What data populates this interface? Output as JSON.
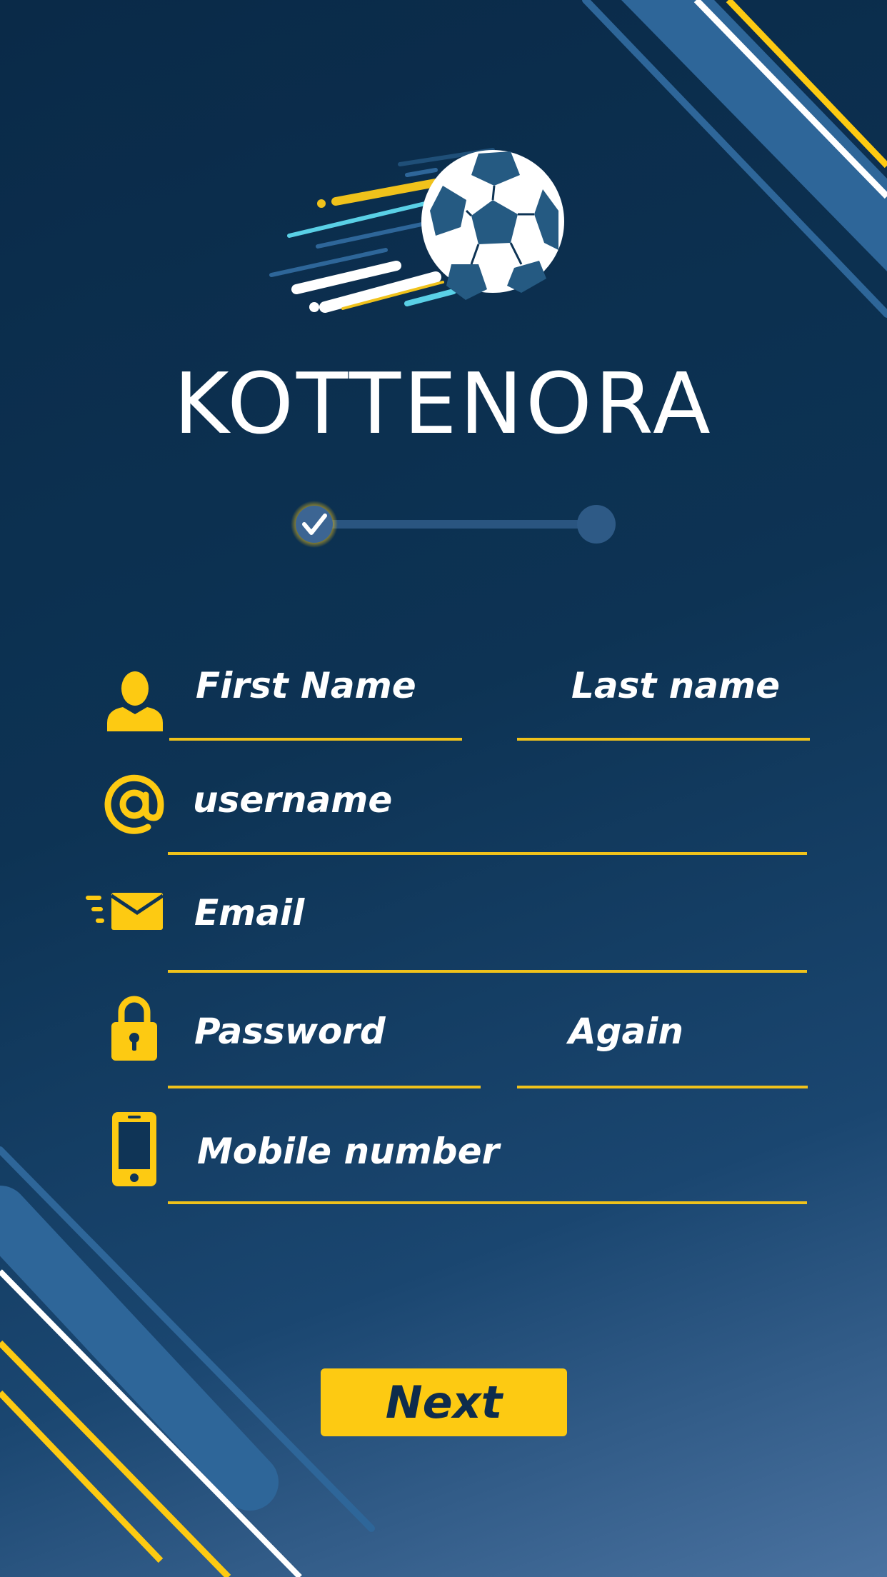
{
  "app": {
    "brand": "KOTTENORA"
  },
  "stepper": {
    "current_step": 1,
    "total_steps": 2
  },
  "form": {
    "first_name": {
      "placeholder": "First Name",
      "icon": "person-icon"
    },
    "last_name": {
      "placeholder": "Last name"
    },
    "username": {
      "placeholder": "username",
      "icon": "at-sign-icon"
    },
    "email": {
      "placeholder": "Email",
      "icon": "envelope-icon"
    },
    "password": {
      "placeholder": "Password",
      "icon": "lock-icon"
    },
    "password_again": {
      "placeholder": "Again"
    },
    "mobile": {
      "placeholder": "Mobile number",
      "icon": "mobile-phone-icon"
    }
  },
  "actions": {
    "next_label": "Next"
  },
  "colors": {
    "accent": "#fdca12",
    "background_top": "#0a2a48",
    "background_bottom": "#4a72a0",
    "stripe_blue": "#2e6699",
    "text": "#ffffff"
  }
}
